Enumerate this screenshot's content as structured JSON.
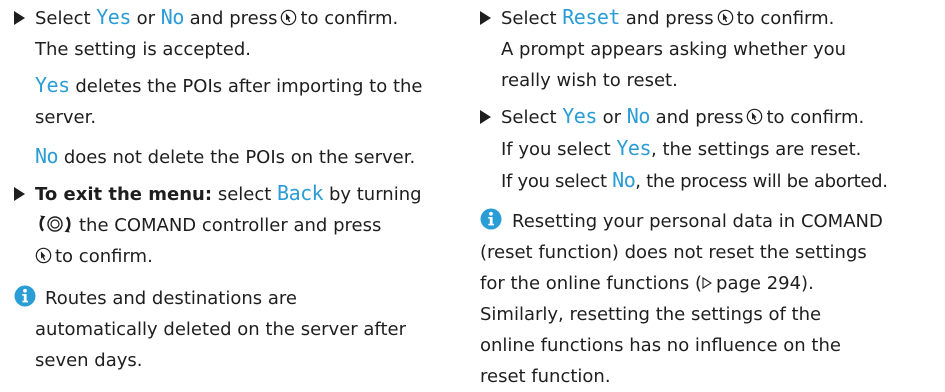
{
  "left": {
    "step1": {
      "pre": "Select",
      "yes": "Yes",
      "or": "or",
      "no": "No",
      "post": "and press",
      "post2": "to confirm.",
      "result": "The setting is accepted."
    },
    "yes_note": {
      "kw": "Yes",
      "line1_rest": "deletes the POIs after importing to the",
      "line2": "server."
    },
    "no_note": {
      "kw": "No",
      "rest": "does not delete the POIs on the server."
    },
    "step2": {
      "bold": "To exit the menu:",
      "pre": "select",
      "kw": "Back",
      "post": "by turning",
      "line2": "the COMAND controller and press",
      "line3": "to confirm."
    },
    "info": {
      "line1": "Routes and destinations are",
      "line2": "automatically deleted on the server after",
      "line3": "seven days."
    }
  },
  "right": {
    "step1": {
      "pre": "Select",
      "kw": "Reset",
      "post": "and press",
      "post2": "to confirm.",
      "line2": "A prompt appears asking whether you",
      "line3": "really wish to reset."
    },
    "step2": {
      "pre": "Select",
      "yes": "Yes",
      "or": "or",
      "no": "No",
      "post": "and press",
      "post2": "to confirm.",
      "line2_pre": "If you select",
      "line2_kw": "Yes",
      "line2_post": ", the settings are reset.",
      "line3_pre": "If you select",
      "line3_kw": "No",
      "line3_post": ", the process will be aborted."
    },
    "info": {
      "line1": "Resetting your personal data in COMAND",
      "line2": "(reset function) does not reset the settings",
      "line3_pre": "for the online functions (",
      "line3_page": "page 294).",
      "line4": "Similarly, resetting the settings of the",
      "line5": "online functions has no influence on the",
      "line6": "reset function."
    }
  },
  "icons": {
    "bullet": "triangle-bullet-icon",
    "press": "press-controller-icon",
    "turn": "turn-controller-icon",
    "info": "info-icon",
    "ref": "page-reference-arrow-icon"
  },
  "colors": {
    "keyword": "#2a9cd6",
    "text": "#1e1e1e"
  }
}
